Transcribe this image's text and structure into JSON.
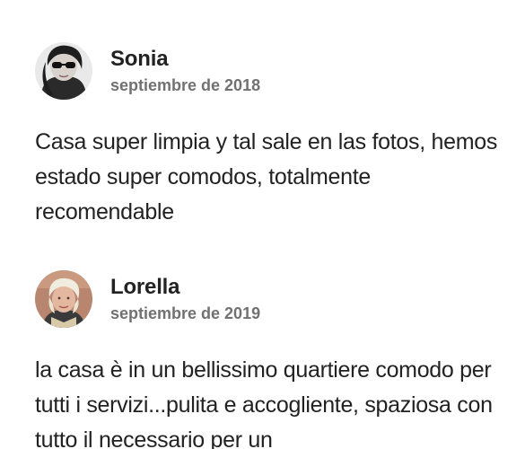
{
  "reviews": [
    {
      "name": "Sonia",
      "date": "septiembre de 2018",
      "text": "Casa super limpia y tal sale en las fotos, hemos estado super comodos, totalmente recomendable",
      "avatar_icon": "profile-photo-sunglasses"
    },
    {
      "name": "Lorella",
      "date": "septiembre de 2019",
      "text": "la casa è in un bellissimo quartiere comodo per tutti i servizi...pulita e accogliente, spaziosa con tutto il necessario per un",
      "avatar_icon": "profile-photo-blonde"
    }
  ],
  "colors": {
    "primary_text": "#222222",
    "secondary_text": "#717171",
    "background": "#ffffff"
  }
}
